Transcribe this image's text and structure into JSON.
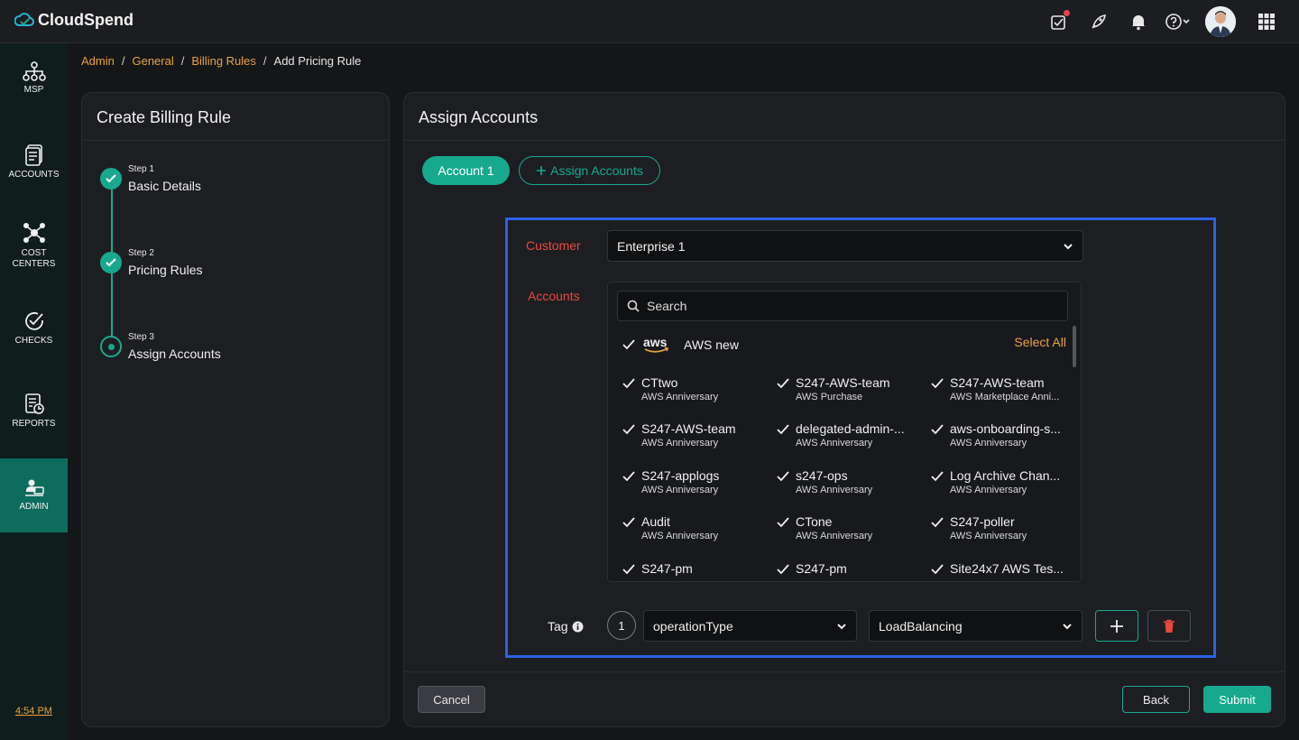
{
  "app": {
    "name": "CloudSpend"
  },
  "topbar": {
    "icons": [
      "task-icon",
      "rocket-icon",
      "bell-icon",
      "help-icon",
      "avatar",
      "apps-grid-icon"
    ]
  },
  "breadcrumb": {
    "items": [
      "Admin",
      "General",
      "Billing Rules"
    ],
    "current": "Add Pricing Rule",
    "separator": "/"
  },
  "sidebar": {
    "items": [
      {
        "label": "MSP",
        "icon": "org-chart-icon"
      },
      {
        "label": "ACCOUNTS",
        "icon": "accounts-icon"
      },
      {
        "label_line1": "COST",
        "label_line2": "CENTERS",
        "icon": "cost-centers-icon"
      },
      {
        "label": "CHECKS",
        "icon": "checks-icon"
      },
      {
        "label": "REPORTS",
        "icon": "reports-icon"
      },
      {
        "label": "ADMIN",
        "icon": "admin-icon",
        "active": true
      }
    ],
    "time": "4:54 PM"
  },
  "left_panel": {
    "title": "Create Billing Rule",
    "steps": [
      {
        "step": "Step 1",
        "name": "Basic Details",
        "status": "done"
      },
      {
        "step": "Step 2",
        "name": "Pricing Rules",
        "status": "done"
      },
      {
        "step": "Step 3",
        "name": "Assign Accounts",
        "status": "current"
      }
    ]
  },
  "right_panel": {
    "title": "Assign Accounts",
    "tabs": {
      "active": "Account 1",
      "add": "Assign Accounts"
    },
    "customer": {
      "label": "Customer",
      "value": "Enterprise 1"
    },
    "accounts": {
      "label": "Accounts",
      "search_placeholder": "Search",
      "group_logo": "aws",
      "group_name": "AWS new",
      "select_all": "Select All",
      "items": [
        {
          "name": "CTtwo",
          "type": "AWS Anniversary"
        },
        {
          "name": "S247-AWS-team",
          "type": "AWS Purchase"
        },
        {
          "name": "S247-AWS-team",
          "type": "AWS Marketplace Anni..."
        },
        {
          "name": "S247-AWS-team",
          "type": "AWS Anniversary"
        },
        {
          "name": "delegated-admin-...",
          "type": "AWS Anniversary"
        },
        {
          "name": "aws-onboarding-s...",
          "type": "AWS Anniversary"
        },
        {
          "name": "S247-applogs",
          "type": "AWS Anniversary"
        },
        {
          "name": "s247-ops",
          "type": "AWS Anniversary"
        },
        {
          "name": "Log Archive Chan...",
          "type": "AWS Anniversary"
        },
        {
          "name": "Audit",
          "type": "AWS Anniversary"
        },
        {
          "name": "CTone",
          "type": "AWS Anniversary"
        },
        {
          "name": "S247-poller",
          "type": "AWS Anniversary"
        },
        {
          "name": "S247-pm",
          "type": ""
        },
        {
          "name": "S247-pm",
          "type": ""
        },
        {
          "name": "Site24x7 AWS Tes...",
          "type": ""
        }
      ]
    },
    "tag": {
      "label": "Tag",
      "index": "1",
      "key": "operationType",
      "value": "LoadBalancing"
    },
    "buttons": {
      "cancel": "Cancel",
      "back": "Back",
      "submit": "Submit"
    }
  },
  "colors": {
    "accent": "#17a98d",
    "link": "#e8a33d",
    "required": "#e8493d",
    "highlight": "#2c62e8"
  }
}
